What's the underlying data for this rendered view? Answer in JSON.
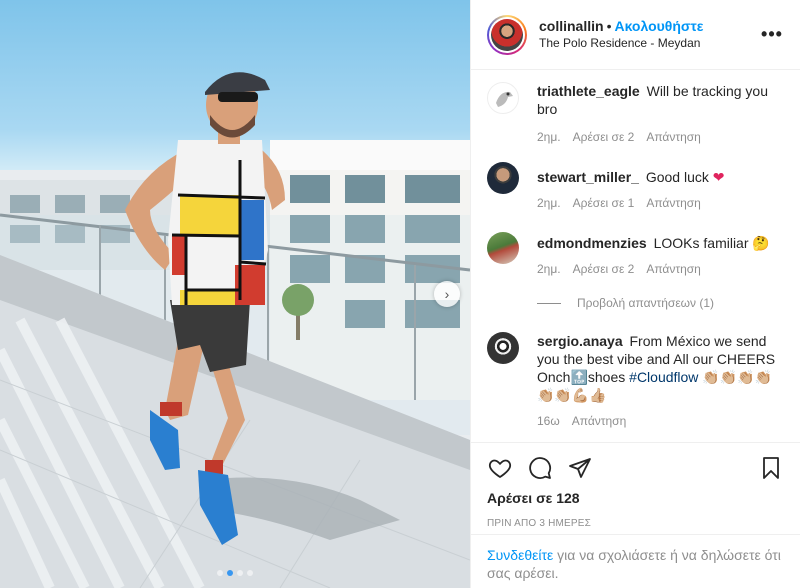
{
  "post": {
    "username": "collinallin",
    "separator": "•",
    "follow_label": "Ακολουθήστε",
    "location": "The Polo Residence - Meydan",
    "more_icon": "more-options-icon"
  },
  "comments": [
    {
      "user": "triathlete_eagle",
      "text": "Will be tracking you bro",
      "age": "2ημ.",
      "likes": "Αρέσει σε 2",
      "reply": "Απάντηση"
    },
    {
      "user": "stewart_miller_",
      "text": "Good luck",
      "emoji": "❤",
      "age": "2ημ.",
      "likes": "Αρέσει σε 1",
      "reply": "Απάντηση"
    },
    {
      "user": "edmondmenzies",
      "text": "LOOKs familiar",
      "emoji": "🤔",
      "age": "2ημ.",
      "likes": "Αρέσει σε 2",
      "reply": "Απάντηση"
    },
    {
      "user": "sergio.anaya",
      "text": "From México we send you the best vibe and All our CHEERS Onch🔝shoes",
      "hashtag": "#Cloudflow",
      "emoji": "👏🏼👏🏼👏🏼👏🏼👏🏼👏🏼💪🏼👍🏼",
      "age": "16ω",
      "reply": "Απάντηση"
    }
  ],
  "view_replies": "Προβολή απαντήσεων (1)",
  "actions": {
    "like_icon": "heart-icon",
    "comment_icon": "comment-icon",
    "share_icon": "share-icon",
    "save_icon": "bookmark-icon",
    "likes_count": "Αρέσει σε 128",
    "time_ago": "ΠΡΙΝ ΑΠΟ 3 ΗΜΕΡΕΣ"
  },
  "login_prompt": {
    "link": "Συνδεθείτε",
    "text": " για να σχολιάσετε ή να δηλώσετε ότι σας αρέσει."
  },
  "colors": {
    "link_blue": "#0095f6",
    "hashtag": "#00376b",
    "muted": "#8e8e8e",
    "text": "#262626"
  },
  "carousel": {
    "slides": 4,
    "active": 1
  }
}
